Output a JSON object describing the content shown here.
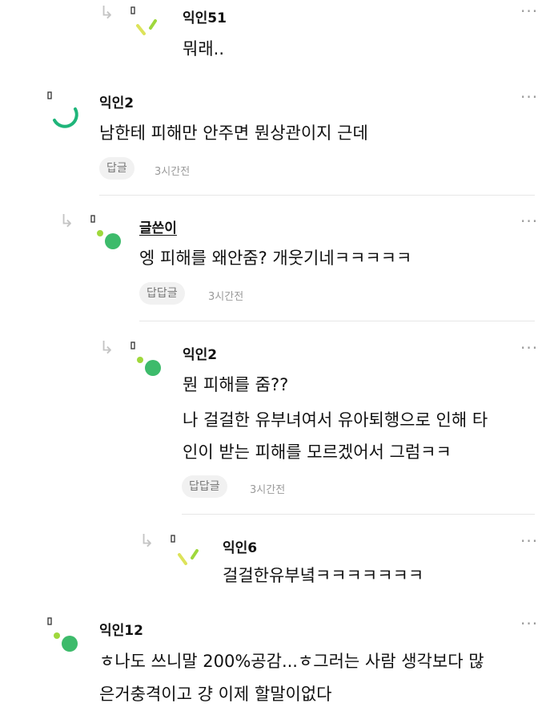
{
  "comments": [
    {
      "name": "익인51",
      "lines": [
        "뭐래.."
      ]
    },
    {
      "name": "익인2",
      "lines": [
        "남한테 피해만 안주면 뭔상관이지 근데"
      ],
      "reply_label": "답글",
      "time": "3시간전"
    },
    {
      "name": "글쓴이",
      "lines": [
        "엥 피해를 왜안줌? 개웃기네ㅋㅋㅋㅋㅋ"
      ],
      "reply_label": "답답글",
      "time": "3시간전"
    },
    {
      "name": "익인2",
      "lines": [
        "뭔 피해를 줌??",
        "나 걸걸한 유부녀여서 유아퇴행으로 인해 타",
        "인이 받는 피해를 모르겠어서 그럼ㅋㅋ"
      ],
      "reply_label": "답답글",
      "time": "3시간전"
    },
    {
      "name": "익인6",
      "lines": [
        "걸걸한유부녘ㅋㅋㅋㅋㅋㅋㅋ"
      ]
    },
    {
      "name": "익인12",
      "lines": [
        "ㅎ나도 쓰니말 200%공감...ㅎ그러는 사람 생각보다 많",
        "은거충격이고 걍 이제 할말이없다"
      ]
    }
  ],
  "icons": {
    "reply": "reply-arrow-icon",
    "more": "more-dots-icon"
  },
  "colors": {
    "green": "#3dbb6b",
    "lime": "#9fd83c",
    "teal": "#1fb57a",
    "yellow": "#dde35a"
  }
}
